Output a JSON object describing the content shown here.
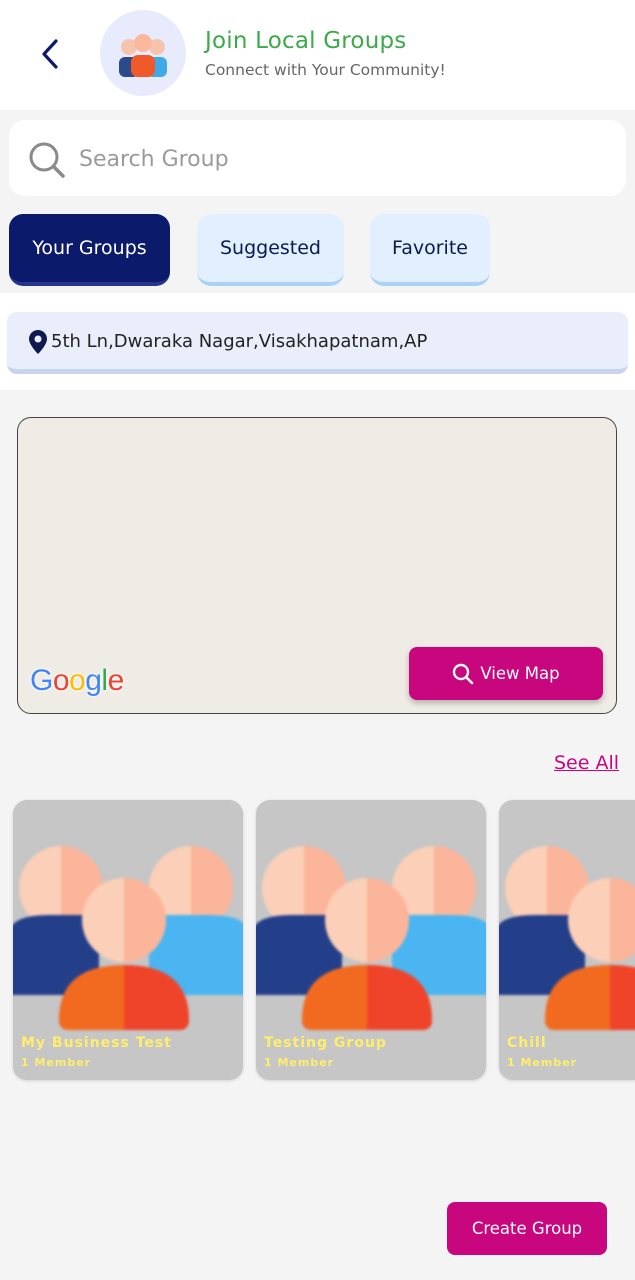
{
  "header": {
    "title": "Join Local Groups",
    "subtitle": "Connect with Your Community!",
    "back_icon": "chevron-left-icon",
    "avatar_icon": "group-people-icon"
  },
  "search": {
    "placeholder": "Search Group",
    "value": "",
    "icon": "search-icon"
  },
  "tabs": [
    {
      "label": "Your Groups",
      "active": true
    },
    {
      "label": "Suggested",
      "active": false
    },
    {
      "label": "Favorite",
      "active": false
    }
  ],
  "location": {
    "icon": "location-pin-icon",
    "address": "5th Ln,Dwaraka Nagar,Visakhapatnam,AP"
  },
  "map": {
    "provider_logo": "Google",
    "view_map_label": "View Map"
  },
  "groups": {
    "see_all_label": "See All",
    "items": [
      {
        "name": "My Business Test",
        "members": "1 Member"
      },
      {
        "name": "Testing Group",
        "members": "1 Member"
      },
      {
        "name": "Chill",
        "members": "1 Member"
      }
    ]
  },
  "create_group_label": "Create Group",
  "colors": {
    "primary": "#c8077f",
    "navy": "#0b1a6a",
    "title_green": "#3aaa4a",
    "card_text": "#ffee6b"
  }
}
